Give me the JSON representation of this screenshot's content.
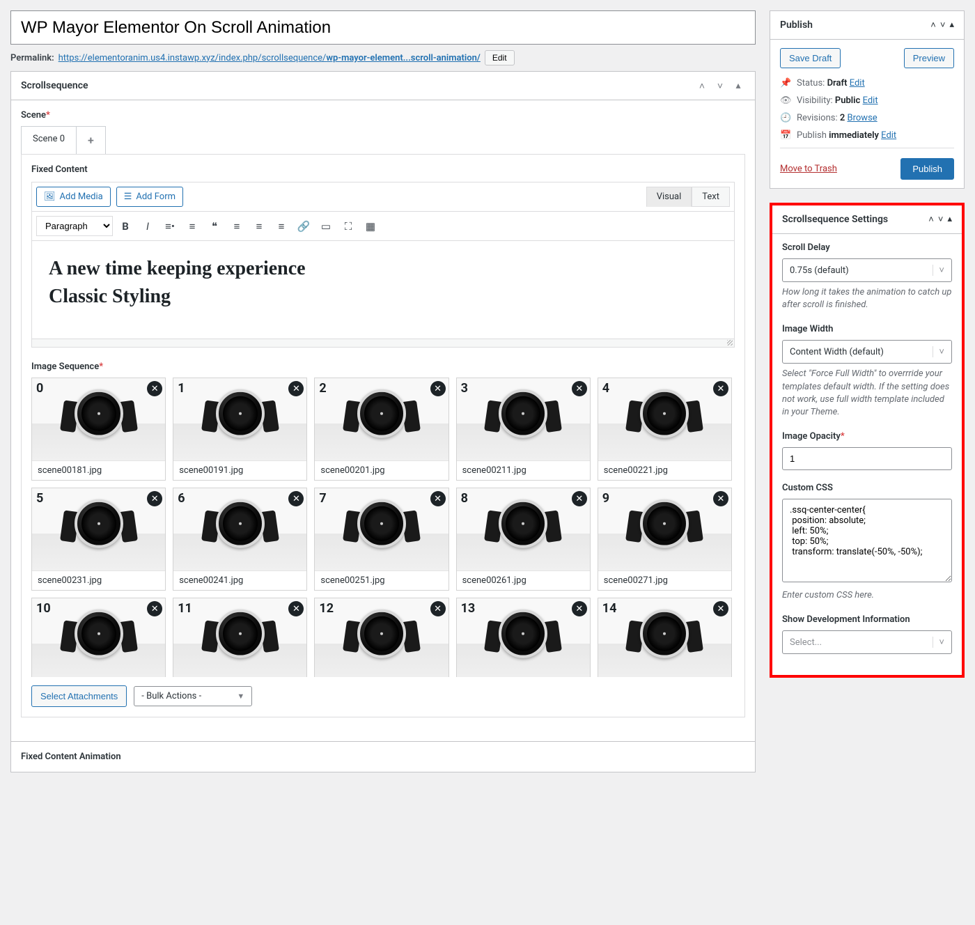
{
  "post": {
    "title": "WP Mayor Elementor On Scroll Animation",
    "permalink_label": "Permalink:",
    "permalink_base": "https://elementoranim.us4.instawp.xyz/index.php/scrollsequence/",
    "permalink_slug": "wp-mayor-element...scroll-animation/",
    "permalink_edit": "Edit"
  },
  "scrollseq": {
    "title": "Scrollsequence",
    "scene_label": "Scene",
    "tabs": {
      "scene0": "Scene 0",
      "add": "+"
    },
    "fixed_content_label": "Fixed Content",
    "editor": {
      "add_media": "Add Media",
      "add_form": "Add Form",
      "tab_visual": "Visual",
      "tab_text": "Text",
      "fmt_select": "Paragraph",
      "heading1": "A new time keeping experience",
      "heading2": "Classic Styling"
    },
    "img_seq_label": "Image Sequence",
    "images": [
      {
        "n": "0",
        "f": "scene00181.jpg"
      },
      {
        "n": "1",
        "f": "scene00191.jpg"
      },
      {
        "n": "2",
        "f": "scene00201.jpg"
      },
      {
        "n": "3",
        "f": "scene00211.jpg"
      },
      {
        "n": "4",
        "f": "scene00221.jpg"
      },
      {
        "n": "5",
        "f": "scene00231.jpg"
      },
      {
        "n": "6",
        "f": "scene00241.jpg"
      },
      {
        "n": "7",
        "f": "scene00251.jpg"
      },
      {
        "n": "8",
        "f": "scene00261.jpg"
      },
      {
        "n": "9",
        "f": "scene00271.jpg"
      },
      {
        "n": "10",
        "f": ""
      },
      {
        "n": "11",
        "f": ""
      },
      {
        "n": "12",
        "f": ""
      },
      {
        "n": "13",
        "f": ""
      },
      {
        "n": "14",
        "f": ""
      }
    ],
    "select_attachments": "Select Attachments",
    "bulk_actions": "- Bulk Actions -",
    "fixed_anim_label": "Fixed Content Animation"
  },
  "publish": {
    "title": "Publish",
    "save_draft": "Save Draft",
    "preview": "Preview",
    "status_label": "Status:",
    "status_value": "Draft",
    "edit": "Edit",
    "visibility_label": "Visibility:",
    "visibility_value": "Public",
    "revisions_label": "Revisions:",
    "revisions_count": "2",
    "browse": "Browse",
    "publish_label": "Publish",
    "publish_value": "immediately",
    "trash": "Move to Trash",
    "publish_btn": "Publish"
  },
  "settings": {
    "title": "Scrollsequence Settings",
    "scroll_delay_label": "Scroll Delay",
    "scroll_delay_value": "0.75s (default)",
    "scroll_delay_help": "How long it takes the animation to catch up after scroll is finished.",
    "image_width_label": "Image Width",
    "image_width_value": "Content Width (default)",
    "image_width_help": "Select \"Force Full Width\" to overrride your templates default width. If the setting does not work, use full width template included in your Theme.",
    "opacity_label": "Image Opacity",
    "opacity_value": "1",
    "custom_css_label": "Custom CSS",
    "custom_css_value": ".ssq-center-center{\n position: absolute;\n left: 50%;\n top: 50%;\n transform: translate(-50%, -50%);",
    "custom_css_help": "Enter custom CSS here.",
    "dev_info_label": "Show Development Information",
    "dev_info_placeholder": "Select..."
  }
}
